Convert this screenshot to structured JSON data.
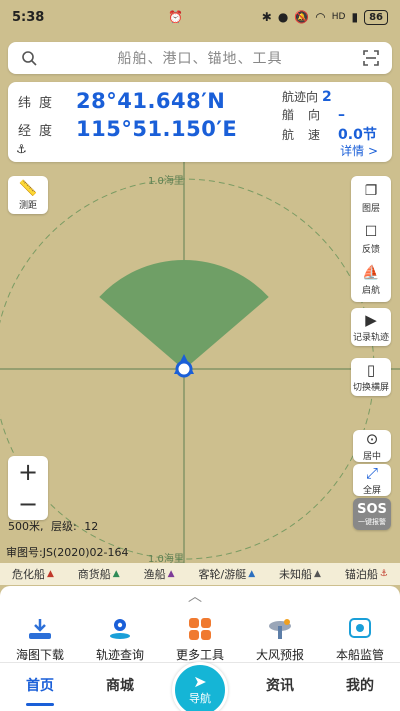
{
  "status_bar": {
    "time": "5:38",
    "center_icon": "alarm-icon",
    "icons": [
      "bluetooth-icon",
      "location-icon",
      "mute-icon",
      "wifi-icon",
      "hd-icon",
      "signal-icon"
    ],
    "battery": "86"
  },
  "search": {
    "placeholder": "船舶、港口、锚地、工具"
  },
  "coords": {
    "lat_label": "纬度",
    "lat_value": "28°41.648′N",
    "lon_label": "经度",
    "lon_value": "115°51.150′E",
    "track_label": "航迹向",
    "track_value": "2",
    "heading_label": "艏向",
    "heading_value": "–",
    "speed_label": "航速",
    "speed_value": "0.0节",
    "details": "详情 >"
  },
  "map": {
    "ring_label_top": "1.0海里",
    "ring_label_bottom": "1.0海里",
    "background_color": "#cdbf8e",
    "sector_color": "#6f9f66"
  },
  "tools": {
    "measure": "测距",
    "layers": "图层",
    "feedback": "反馈",
    "sail": "启航",
    "record_track": "记录轨迹",
    "landscape": "切换横屏",
    "center": "居中",
    "fullscreen": "全屏",
    "sos": "SOS",
    "sos_sub": "一键报警",
    "zoom_in": "+",
    "zoom_out": "−"
  },
  "scale": {
    "distance": "500米,",
    "level_label": "层级:",
    "level_value": "12"
  },
  "approval": "审图号:JS(2020)02-164",
  "legend": [
    "危化船",
    "商货船",
    "渔船",
    "客轮/游艇",
    "未知船",
    "锚泊船"
  ],
  "bottom_tools": [
    "海图下载",
    "轨迹查询",
    "更多工具",
    "大风预报",
    "本船监管"
  ],
  "tabs": {
    "home": "首页",
    "mall": "商城",
    "nav": "导航",
    "news": "资讯",
    "mine": "我的"
  },
  "colors": {
    "accent": "#1a5fd8",
    "nav_button": "#15b5d6"
  }
}
